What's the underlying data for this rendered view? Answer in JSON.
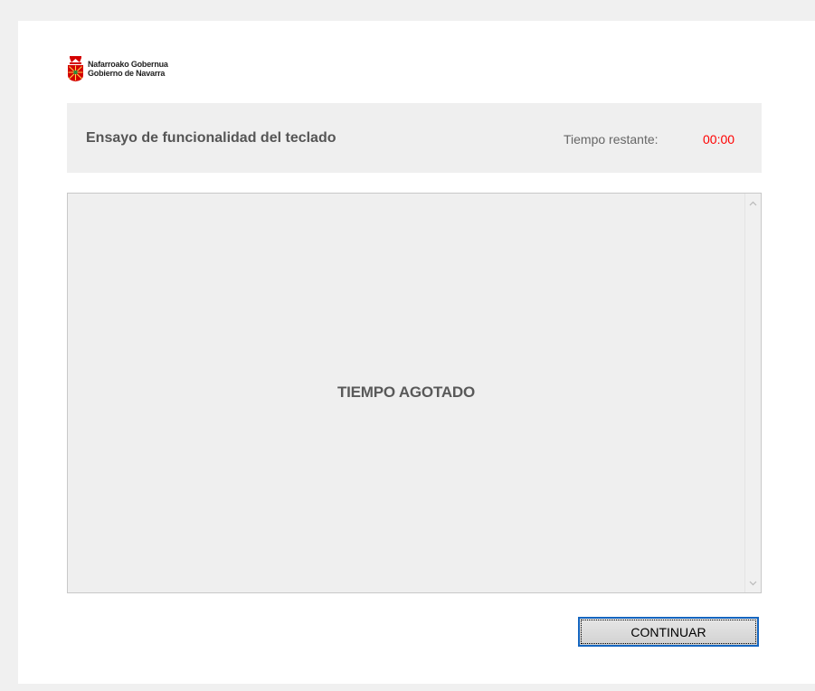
{
  "logo": {
    "line1": "Nafarroako Gobernua",
    "line2": "Gobierno de Navarra",
    "icon": "navarra-coat-of-arms-icon",
    "brand_color": "#d40000"
  },
  "header": {
    "title": "Ensayo de funcionalidad del teclado",
    "timer_label": "Tiempo restante:",
    "timer_value": "00:00",
    "timer_color": "#ff0000"
  },
  "main": {
    "message": "TIEMPO AGOTADO",
    "scroll_up_icon": "chevron-up-icon",
    "scroll_down_icon": "chevron-down-icon"
  },
  "footer": {
    "continue_label": "CONTINUAR",
    "button_border_color": "#1566c0"
  }
}
